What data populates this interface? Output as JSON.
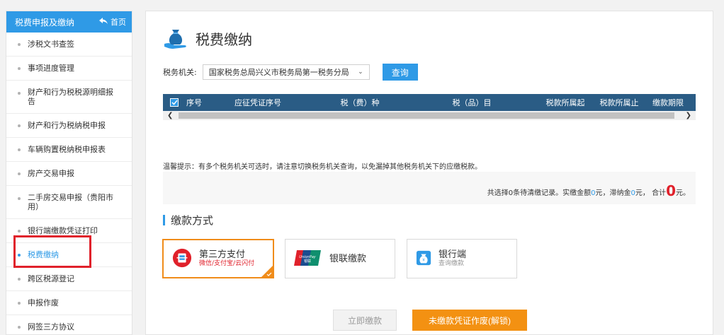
{
  "sidebar": {
    "title": "税费申报及缴纳",
    "home_label": "首页",
    "items": [
      {
        "label": "涉税文书查签"
      },
      {
        "label": "事项进度管理"
      },
      {
        "label": "财产和行为税税源明细报告"
      },
      {
        "label": "财产和行为税纳税申报"
      },
      {
        "label": "车辆购置税纳税申报表"
      },
      {
        "label": "房产交易申报"
      },
      {
        "label": "二手房交易申报（贵阳市用）"
      },
      {
        "label": "银行端缴款凭证打印"
      },
      {
        "label": "税费缴纳"
      },
      {
        "label": "跨区税源登记"
      },
      {
        "label": "申报作废"
      },
      {
        "label": "网签三方协议"
      }
    ]
  },
  "main": {
    "title": "税费缴纳",
    "tax_office_label": "税务机关:",
    "tax_office_value": "国家税务总局兴义市税务局第一税务分局",
    "query_button": "查询",
    "table": {
      "columns": [
        "序号",
        "应征凭证序号",
        "税（费）种",
        "税（品）目",
        "税款所属起",
        "税款所属止",
        "缴款期限"
      ]
    },
    "tip": "温馨提示：有多个税务机关可选时，请注意切换税务机关查询，以免漏掉其他税务机关下的应缴税款。",
    "summary": {
      "prefix": "共选择0条待清缴记录。实缴金额",
      "paid_amount": "0",
      "mid1": "元，滞纳金",
      "late_fee": "0",
      "mid2": "元， 合计",
      "total": "0",
      "suffix": "元。"
    },
    "payment_section_title": "缴款方式",
    "payment_methods": [
      {
        "label": "第三方支付",
        "sub": "微信/支付宝/云闪付",
        "selected": true
      },
      {
        "label": "银联缴款",
        "sub": "",
        "selected": false
      },
      {
        "label": "银行端",
        "sub": "查询缴款",
        "selected": false
      }
    ],
    "pay_now_button": "立即缴款",
    "void_button": "未缴款凭证作废(解锁)"
  },
  "colors": {
    "accent": "#2f9ae6",
    "header_dark": "#2a5c85",
    "warning": "#f39112",
    "red": "#e0212b"
  }
}
